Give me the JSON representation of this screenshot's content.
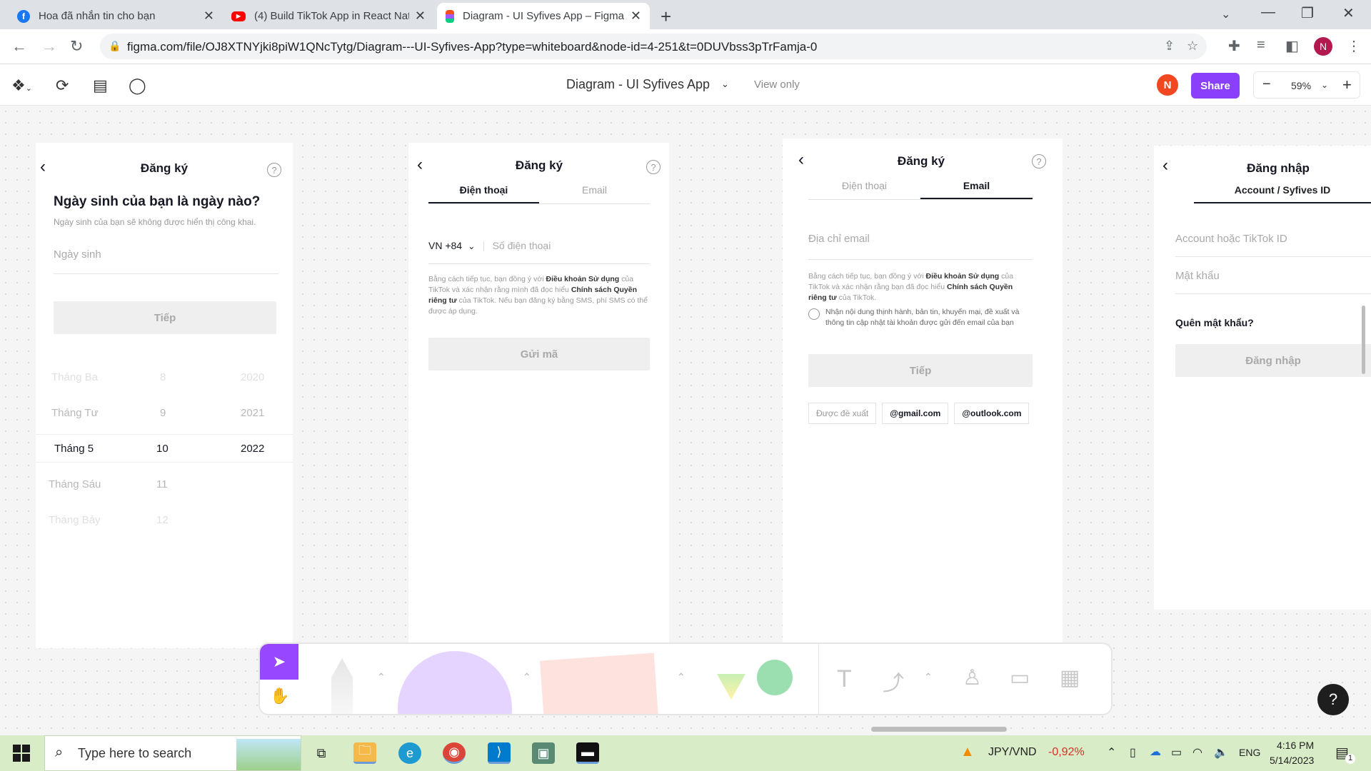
{
  "browser": {
    "tabs": [
      {
        "label": "Hoa đã nhắn tin cho bạn",
        "icon": "facebook-icon"
      },
      {
        "label": "(4) Build TikTok App in React Nat",
        "icon": "youtube-icon"
      },
      {
        "label": "Diagram - UI Syfives App – Figma",
        "icon": "figma-icon"
      }
    ],
    "url": "figma.com/file/OJ8XTNYjki8piW1QNcTytg/Diagram---UI-Syfives-App?type=whiteboard&node-id=4-251&t=0DUVbss3pTrFamja-0",
    "profile_initial": "N"
  },
  "figma": {
    "title": "Diagram - UI Syfives App",
    "view_mode": "View only",
    "user_initial": "N",
    "share_label": "Share",
    "zoom": "59%"
  },
  "frames": {
    "birthday": {
      "title": "Đăng ký",
      "question": "Ngày sinh của bạn là ngày nào?",
      "note": "Ngày sinh của bạn sẽ không được hiển thị công khai.",
      "placeholder": "Ngày sinh",
      "next": "Tiếp",
      "picker": [
        [
          "Tháng Ba",
          "8",
          "2020"
        ],
        [
          "Tháng Tư",
          "9",
          "2021"
        ],
        [
          "Tháng 5",
          "10",
          "2022"
        ],
        [
          "Tháng Sáu",
          "11",
          ""
        ],
        [
          "Tháng Bảy",
          "12",
          ""
        ]
      ]
    },
    "phone": {
      "title": "Đăng ký",
      "tab_phone": "Điện thoại",
      "tab_email": "Email",
      "country": "VN +84",
      "placeholder": "Số điện thoại",
      "legal_1": "Bằng cách tiếp tục, bạn đồng ý với ",
      "legal_terms": "Điều khoản Sử dụng",
      "legal_2": " của TikTok và xác nhận rằng mình đã đọc hiểu ",
      "legal_privacy": "Chính sách Quyền riêng tư",
      "legal_3": " của TikTok. Nếu bạn đăng ký bằng SMS, phí SMS có thể được áp dụng.",
      "send": "Gửi mã"
    },
    "email": {
      "title": "Đăng ký",
      "tab_phone": "Điện thoại",
      "tab_email": "Email",
      "placeholder": "Địa chỉ email",
      "legal_1": "Bằng cách tiếp tục, bạn đồng ý với ",
      "legal_terms": "Điều khoản Sử dụng",
      "legal_2": " của TikTok và xác nhận rằng bạn đã đọc hiểu ",
      "legal_privacy": "Chính sách Quyền riêng tư",
      "legal_3": " của TikTok.",
      "opt_in": "Nhận nội dung thịnh hành, bản tin, khuyến mại, đề xuất và thông tin cập nhật tài khoản được gửi đến email của bạn",
      "next": "Tiếp",
      "suggest_label": "Được đề xuất",
      "suggest_gmail": "@gmail.com",
      "suggest_outlook": "@outlook.com"
    },
    "login": {
      "title": "Đăng nhập",
      "tab": "Account / Syfives ID",
      "account_placeholder": "Account hoặc TikTok ID",
      "password_placeholder": "Mật khẩu",
      "forgot": "Quên mật khẩu?",
      "submit": "Đăng nhập"
    }
  },
  "taskbar": {
    "search_placeholder": "Type here to search",
    "currency": "JPY/VND",
    "currency_change": "-0,92%",
    "lang": "ENG",
    "time": "4:16 PM",
    "date": "5/14/2023",
    "notif_count": "1"
  },
  "colors": {
    "figma_purple": "#8a3ffc",
    "tiktok_dark": "#161823",
    "disabled_bg": "#efefef",
    "negative": "#d93025"
  }
}
